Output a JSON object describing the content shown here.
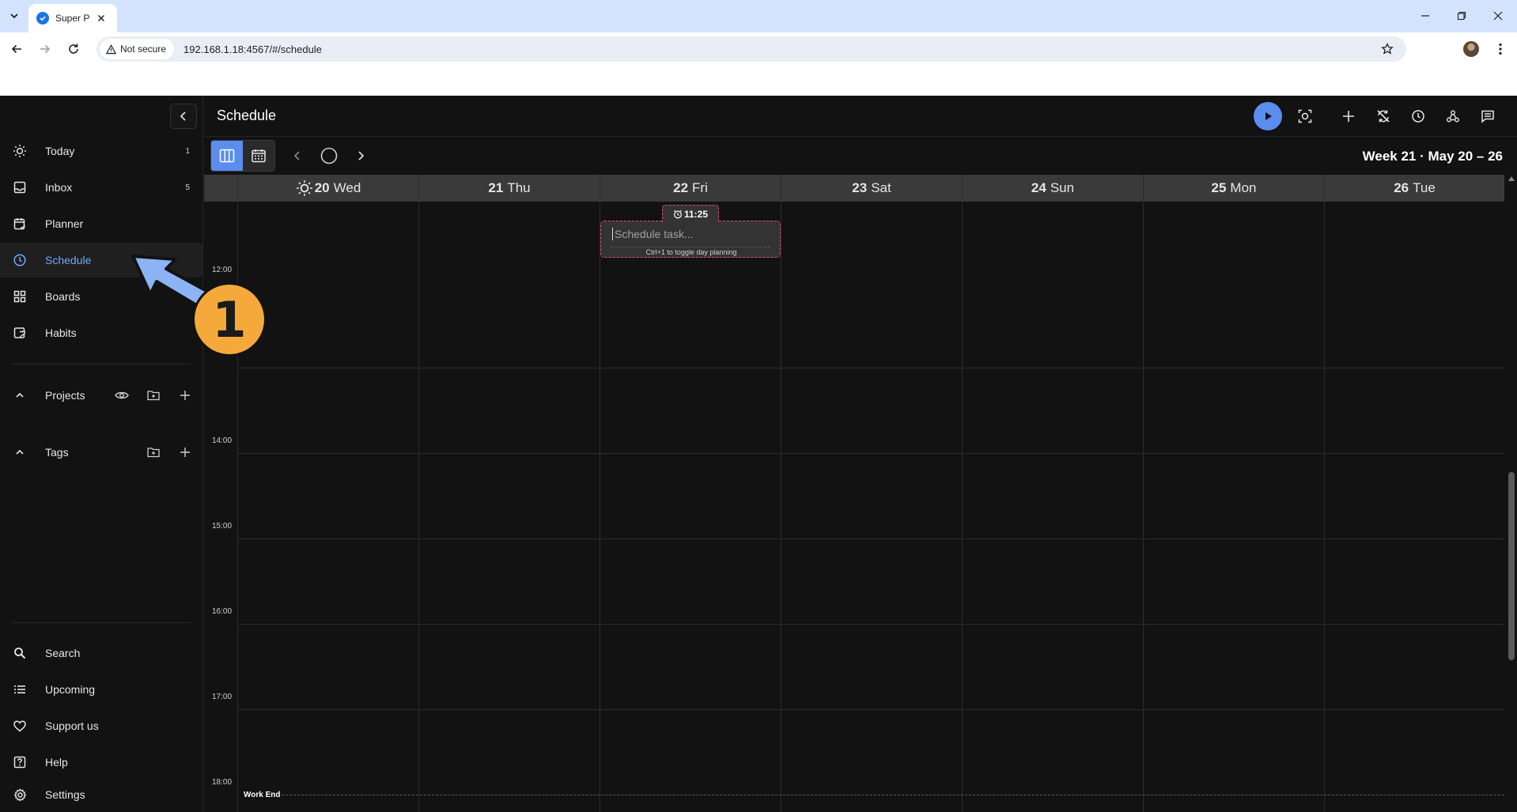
{
  "browser": {
    "tab_title": "Super Pr",
    "security_label": "Not secure",
    "url": "192.168.1.18:4567/#/schedule"
  },
  "sidebar": {
    "nav": [
      {
        "label": "Today",
        "count": "1",
        "icon": "sun-icon"
      },
      {
        "label": "Inbox",
        "count": "5",
        "icon": "inbox-icon"
      },
      {
        "label": "Planner",
        "count": "",
        "icon": "planner-icon"
      },
      {
        "label": "Schedule",
        "count": "",
        "icon": "clock-icon",
        "active": true
      },
      {
        "label": "Boards",
        "count": "",
        "icon": "grid-icon"
      },
      {
        "label": "Habits",
        "count": "",
        "icon": "habit-icon"
      }
    ],
    "projects_label": "Projects",
    "tags_label": "Tags",
    "bottom": [
      {
        "label": "Search",
        "icon": "search-icon"
      },
      {
        "label": "Upcoming",
        "icon": "list-icon"
      },
      {
        "label": "Support us",
        "icon": "heart-icon"
      },
      {
        "label": "Help",
        "icon": "help-icon"
      },
      {
        "label": "Settings",
        "icon": "gear-icon"
      }
    ]
  },
  "header": {
    "title": "Schedule"
  },
  "calendar": {
    "week_label": "Week 21 · May 20 – 26",
    "days": [
      {
        "num": "20",
        "name": "Wed",
        "today": true
      },
      {
        "num": "21",
        "name": "Thu"
      },
      {
        "num": "22",
        "name": "Fri"
      },
      {
        "num": "23",
        "name": "Sat"
      },
      {
        "num": "24",
        "name": "Sun"
      },
      {
        "num": "25",
        "name": "Mon"
      },
      {
        "num": "26",
        "name": "Tue"
      }
    ],
    "time_labels": [
      "12:00",
      "14:00",
      "15:00",
      "16:00",
      "17:00",
      "18:00"
    ],
    "work_end_label": "Work End",
    "schedule_time": "11:25",
    "schedule_placeholder": "Schedule task...",
    "schedule_hint": "Ctrl+1 to toggle day planning"
  },
  "annotation": {
    "step_number": "1"
  },
  "colors": {
    "accent": "#5b8def",
    "active_text": "#6ea8ff",
    "highlight_border": "#e0457b",
    "annotation_badge": "#f6a93b",
    "annotation_arrow": "#8cb4f5"
  }
}
